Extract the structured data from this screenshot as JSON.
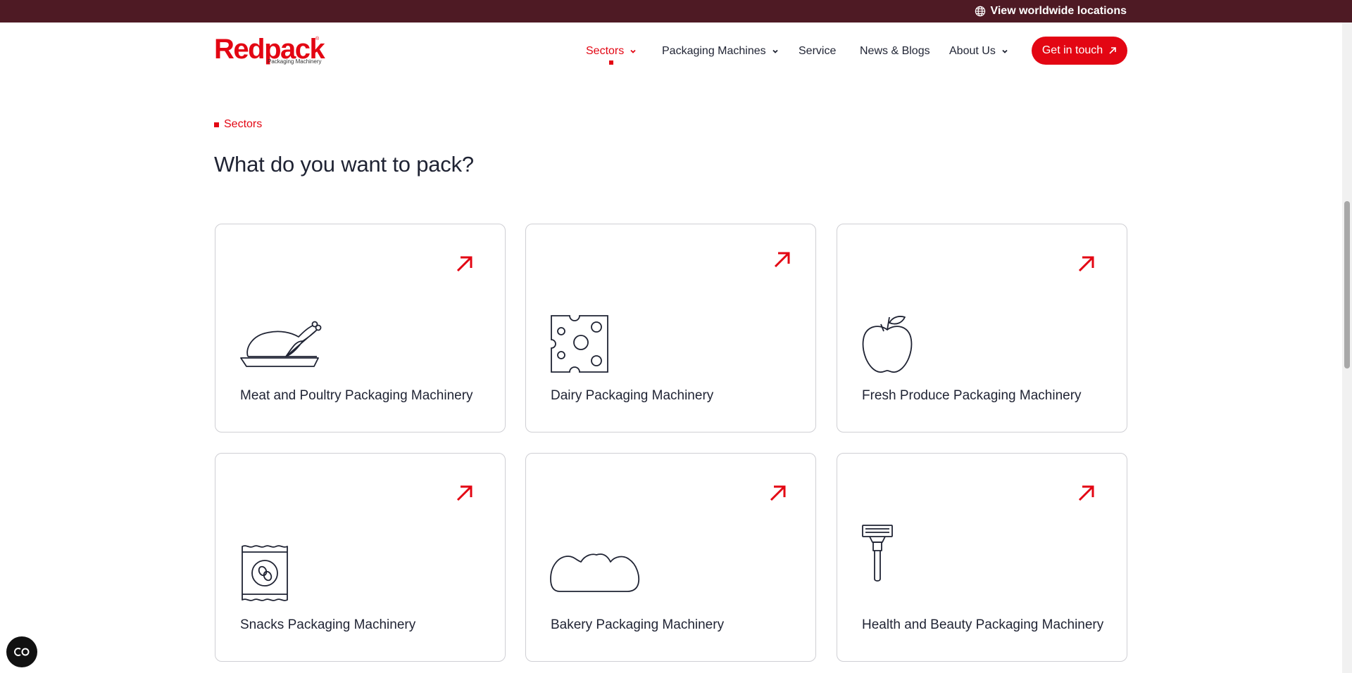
{
  "topbar": {
    "locations_label": "View worldwide locations",
    "background": "#4e1a24",
    "icon": "globe-icon"
  },
  "brand": {
    "name": "Redpack",
    "tagline": "Packaging Machinery",
    "registered": "®",
    "color": "#e30613"
  },
  "nav": {
    "items": [
      {
        "label": "Sectors",
        "has_dropdown": true,
        "active": true
      },
      {
        "label": "Packaging Machines",
        "has_dropdown": true,
        "active": false
      },
      {
        "label": "Service",
        "has_dropdown": false,
        "active": false
      },
      {
        "label": "News & Blogs",
        "has_dropdown": false,
        "active": false
      },
      {
        "label": "About Us",
        "has_dropdown": true,
        "active": false
      }
    ],
    "cta_label": "Get in touch"
  },
  "section": {
    "eyebrow": "Sectors",
    "heading": "What do you want to pack?"
  },
  "cards": [
    {
      "title": "Meat and Poultry Packaging Machinery",
      "icon": "poultry-icon"
    },
    {
      "title": "Dairy Packaging Machinery",
      "icon": "cheese-icon"
    },
    {
      "title": "Fresh Produce Packaging Machinery",
      "icon": "apple-icon"
    },
    {
      "title": "Snacks Packaging Machinery",
      "icon": "snack-bag-icon"
    },
    {
      "title": "Bakery Packaging Machinery",
      "icon": "bread-icon"
    },
    {
      "title": "Health and Beauty Packaging Machinery",
      "icon": "razor-icon"
    }
  ],
  "colors": {
    "accent": "#e30613",
    "text": "#1f2333",
    "card_border": "#cfcfd4"
  }
}
